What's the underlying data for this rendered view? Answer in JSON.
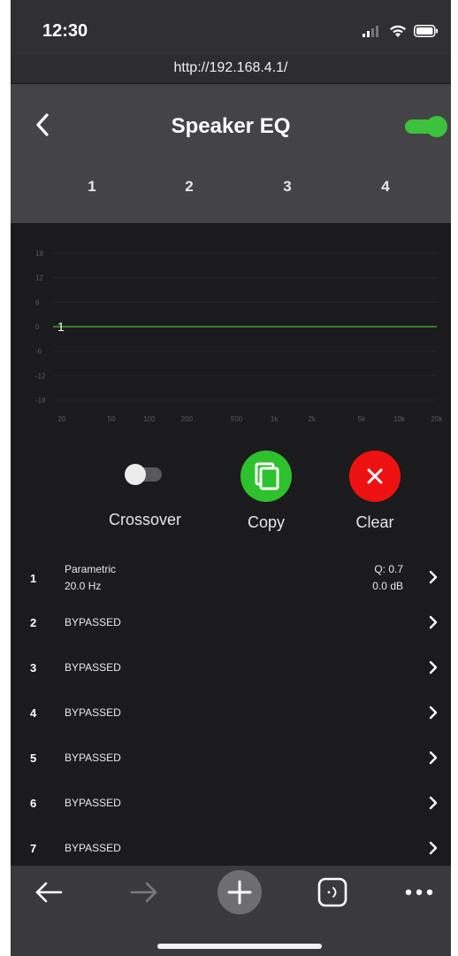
{
  "status_bar": {
    "time": "12:30"
  },
  "browser": {
    "url": "http://192.168.4.1/"
  },
  "header": {
    "title": "Speaker EQ",
    "enabled": true,
    "accent_color": "#3cc23c"
  },
  "tabs": [
    {
      "label": "1",
      "active": true
    },
    {
      "label": "2",
      "active": false
    },
    {
      "label": "3",
      "active": false
    },
    {
      "label": "4",
      "active": false
    }
  ],
  "graph": {
    "y_ticks": [
      "18",
      "12",
      "6",
      "0",
      "-6",
      "-12",
      "-18"
    ],
    "x_ticks": [
      "20",
      "50",
      "100",
      "200",
      "500",
      "1k",
      "2k",
      "5k",
      "10k",
      "20k"
    ],
    "marker_label": "1",
    "curve_color": "#3a7a2a"
  },
  "actions": {
    "crossover_label": "Crossover",
    "copy_label": "Copy",
    "clear_label": "Clear",
    "copy_color": "#2ec12e",
    "clear_color": "#ee1111"
  },
  "filters": [
    {
      "num": "1",
      "label": "Parametric",
      "freq": "20.0 Hz",
      "q": "Q: 0.7",
      "gain": "0.0 dB"
    },
    {
      "num": "2",
      "label": "BYPASSED"
    },
    {
      "num": "3",
      "label": "BYPASSED"
    },
    {
      "num": "4",
      "label": "BYPASSED"
    },
    {
      "num": "5",
      "label": "BYPASSED"
    },
    {
      "num": "6",
      "label": "BYPASSED"
    },
    {
      "num": "7",
      "label": "BYPASSED"
    }
  ]
}
